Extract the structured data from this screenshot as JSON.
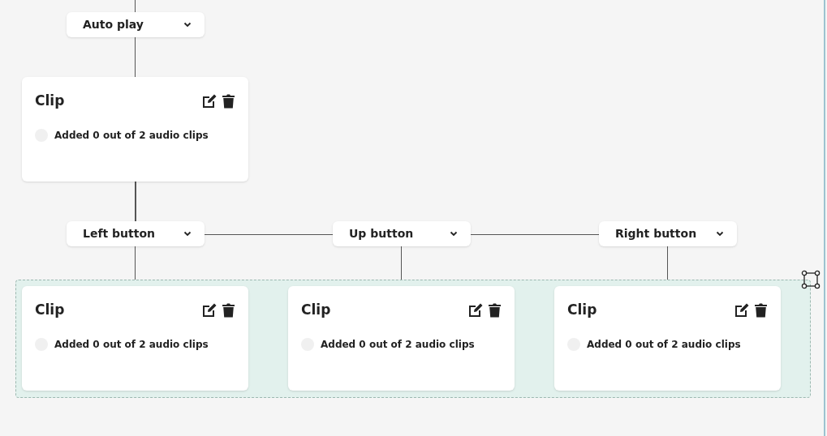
{
  "trigger": {
    "label": "Auto play"
  },
  "clip": {
    "title": "Clip",
    "status": "Added 0 out of 2 audio clips"
  },
  "branches": [
    {
      "label": "Left button",
      "clip": {
        "title": "Clip",
        "status": "Added 0 out of 2 audio clips"
      }
    },
    {
      "label": "Up button",
      "clip": {
        "title": "Clip",
        "status": "Added 0 out of 2 audio clips"
      }
    },
    {
      "label": "Right button",
      "clip": {
        "title": "Clip",
        "status": "Added 0 out of 2 audio clips"
      }
    }
  ]
}
